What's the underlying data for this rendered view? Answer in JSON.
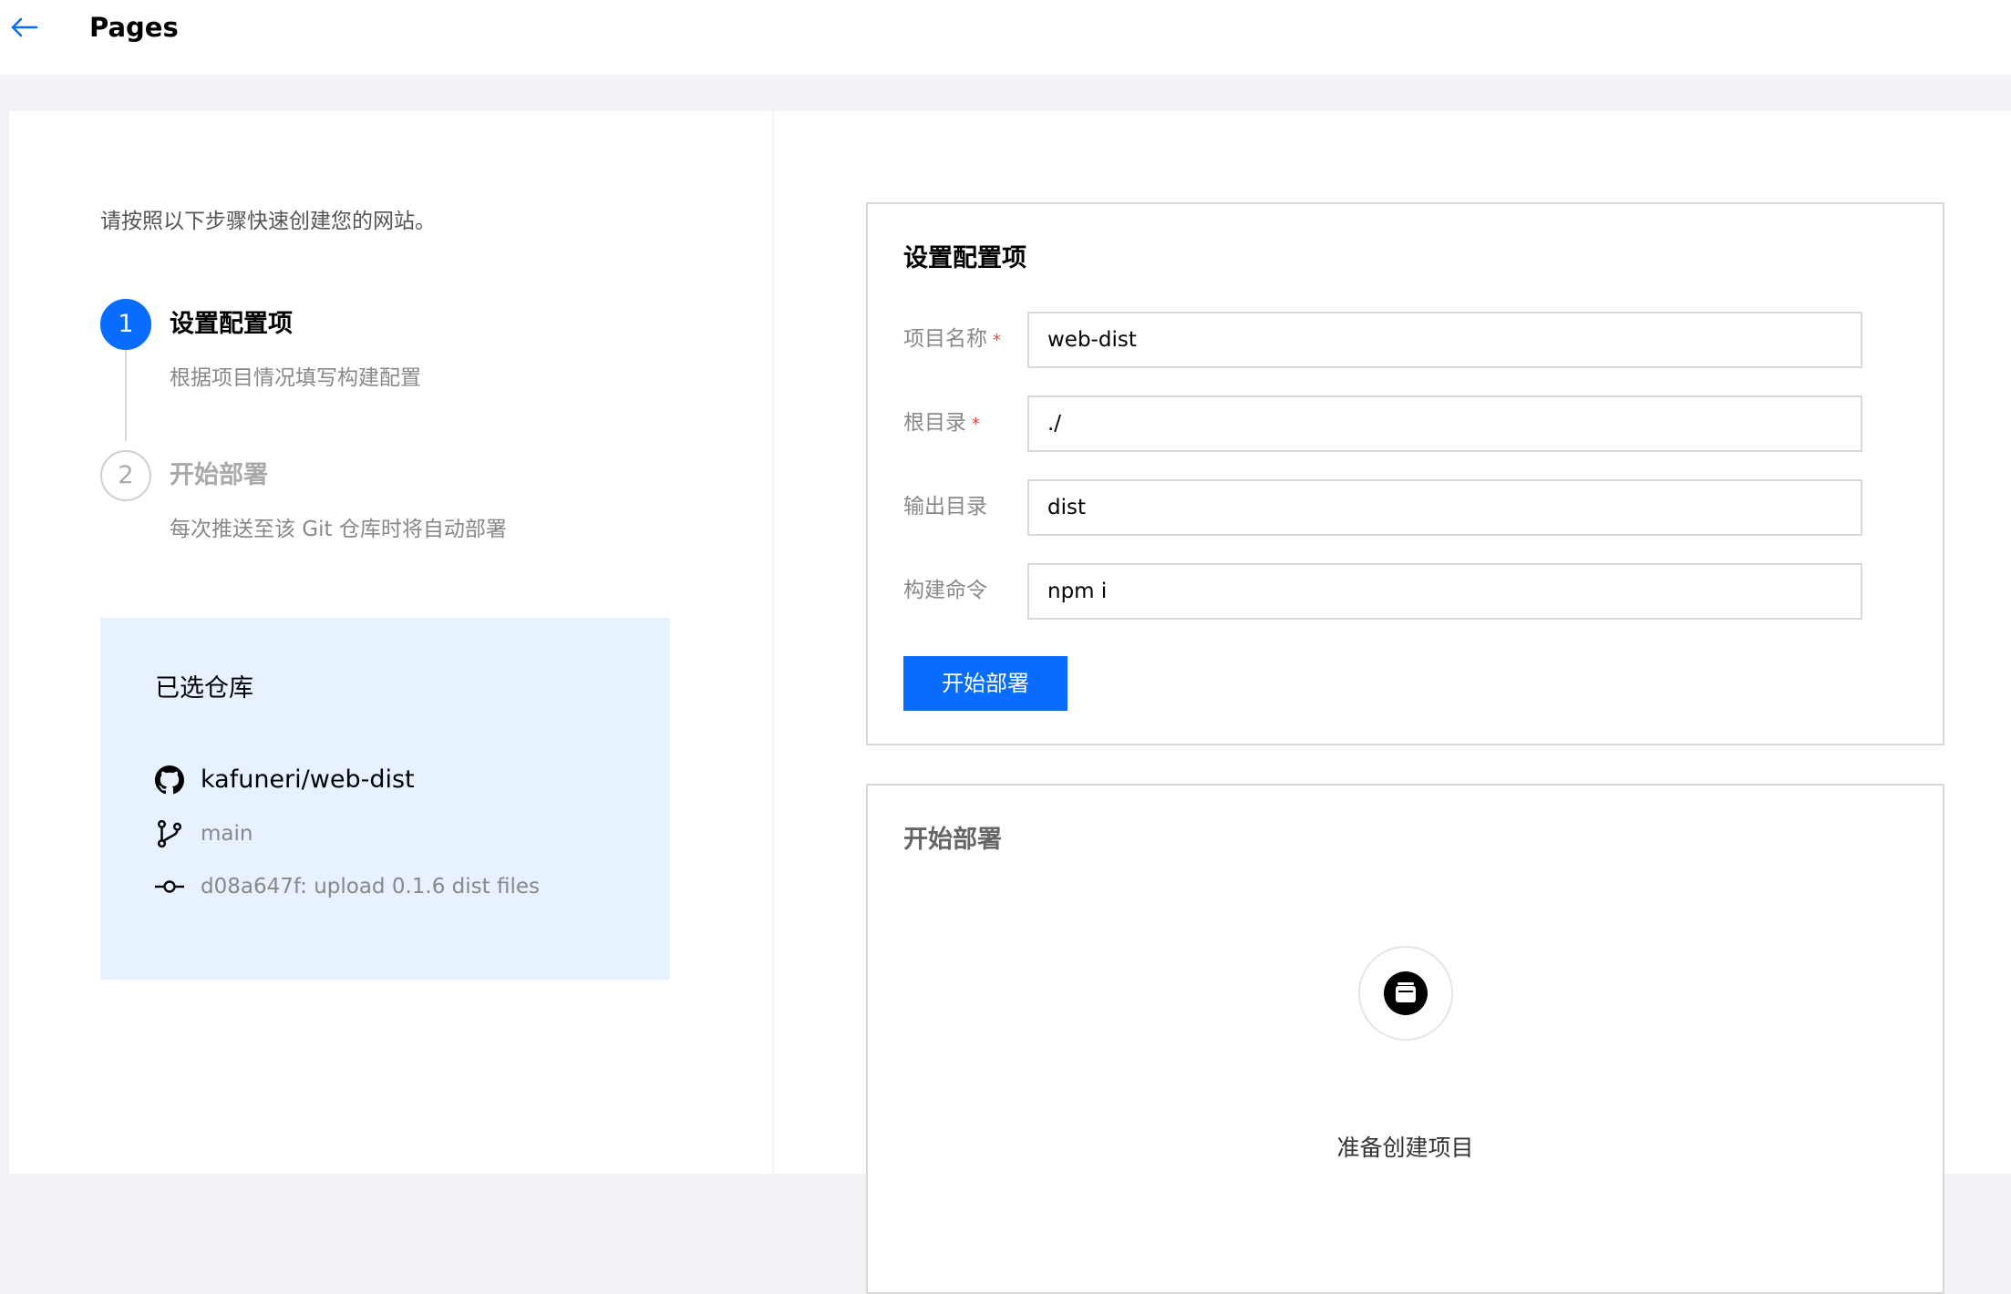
{
  "header": {
    "title": "Pages"
  },
  "intro": "请按照以下步骤快速创建您的网站。",
  "steps": [
    {
      "number": "1",
      "title": "设置配置项",
      "description": "根据项目情况填写构建配置"
    },
    {
      "number": "2",
      "title": "开始部署",
      "description": "每次推送至该 Git 仓库时将自动部署"
    }
  ],
  "repo": {
    "title": "已选仓库",
    "name": "kafuneri/web-dist",
    "branch": "main",
    "commit": "d08a647f: upload 0.1.6 dist files"
  },
  "config_card": {
    "title": "设置配置项",
    "fields": [
      {
        "label": "项目名称",
        "required": true,
        "value": "web-dist"
      },
      {
        "label": "根目录",
        "required": true,
        "value": "./"
      },
      {
        "label": "输出目录",
        "required": false,
        "value": "dist"
      },
      {
        "label": "构建命令",
        "required": false,
        "value": "npm i"
      }
    ],
    "required_mark": "*",
    "submit_label": "开始部署"
  },
  "deploy_card": {
    "title": "开始部署",
    "status": "准备创建项目"
  },
  "colors": {
    "primary": "#0a6cff",
    "repo_bg": "#e7f1ff",
    "required": "#e54545",
    "page_bg": "#f2f3f6"
  }
}
